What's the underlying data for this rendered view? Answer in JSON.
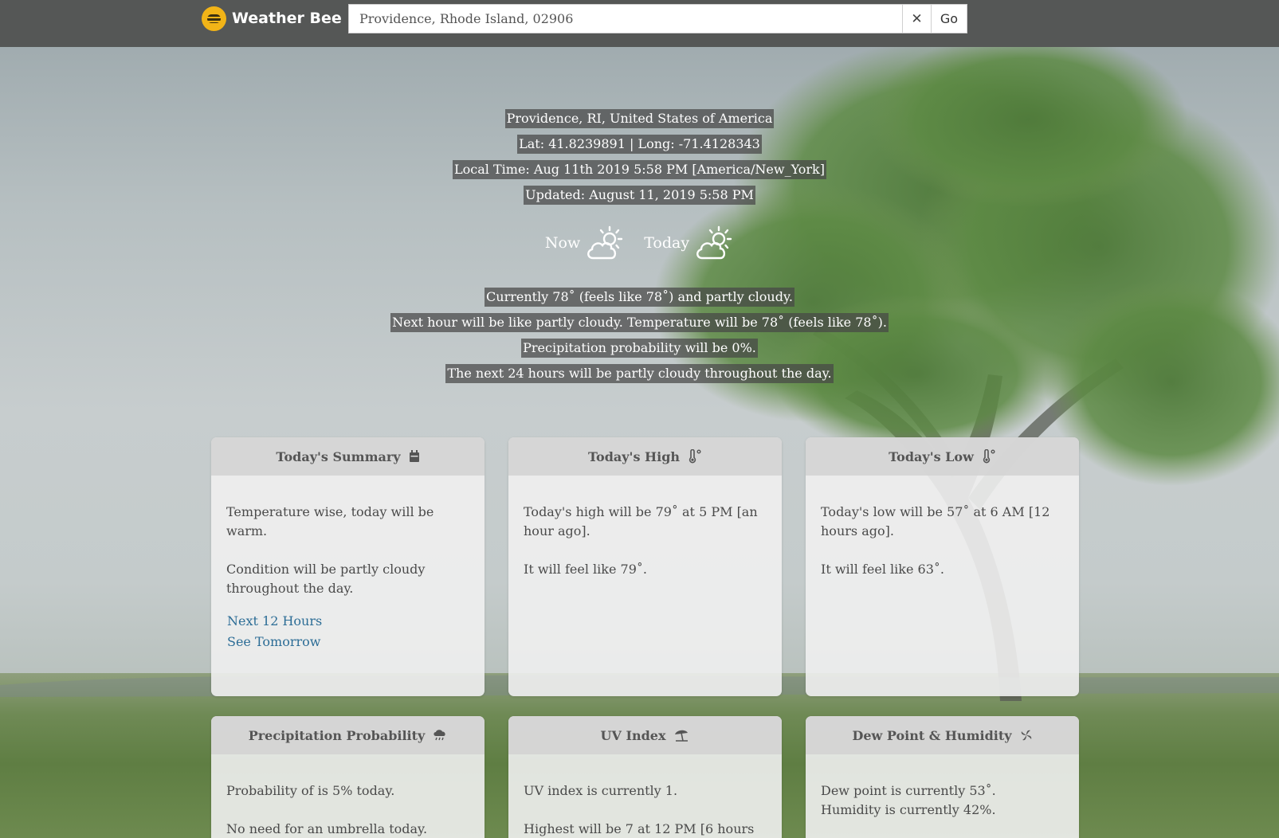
{
  "app": {
    "name": "Weather Bee",
    "logo_icon": "bee-icon"
  },
  "search": {
    "value": "Providence, Rhode Island, 02906",
    "clear_label": "✕",
    "go_label": "Go"
  },
  "location": {
    "place": "Providence, RI, United States of America",
    "coords": "Lat: 41.8239891 | Long: -71.4128343",
    "local_time": "Local Time: Aug 11th 2019 5:58 PM [America/New_York]",
    "updated": "Updated: August 11, 2019 5:58 PM"
  },
  "conditions": {
    "now_label": "Now",
    "now_icon": "partly-cloudy-day-icon",
    "today_label": "Today",
    "today_icon": "partly-cloudy-day-icon"
  },
  "summary_lines": {
    "current": "Currently 78˚ (feels like 78˚) and partly cloudy.",
    "next_hour": "Next hour will be like partly cloudy. Temperature will be 78˚ (feels like 78˚).",
    "precip": "Precipitation probability will be 0%.",
    "next_24": "The next 24 hours will be partly cloudy throughout the day."
  },
  "cards": {
    "summary": {
      "title": "Today's Summary",
      "icon": "calendar-icon",
      "p1": "Temperature wise, today will be warm.",
      "p2": "Condition will be partly cloudy throughout the day.",
      "link1": "Next 12 Hours",
      "link2": "See Tomorrow"
    },
    "high": {
      "title": "Today's High",
      "icon": "thermometer-icon",
      "p1": "Today's high will be 79˚ at 5 PM [an hour ago].",
      "p2": "It will feel like 79˚."
    },
    "low": {
      "title": "Today's Low",
      "icon": "thermometer-icon",
      "p1": "Today's low will be 57˚ at 6 AM [12 hours ago].",
      "p2": "It will feel like 63˚."
    },
    "precip": {
      "title": "Precipitation Probability",
      "icon": "rain-cloud-icon",
      "p1": "Probability of is 5% today.",
      "p2": "No need for an umbrella today."
    },
    "uv": {
      "title": "UV Index",
      "icon": "beach-umbrella-icon",
      "p1": "UV index is currently 1.",
      "p2": "Highest will be 7 at 12 PM [6 hours"
    },
    "dew": {
      "title": "Dew Point & Humidity",
      "icon": "wind-icon",
      "p1": "Dew point is currently 53˚.",
      "p2": "Humidity is currently 42%."
    }
  }
}
